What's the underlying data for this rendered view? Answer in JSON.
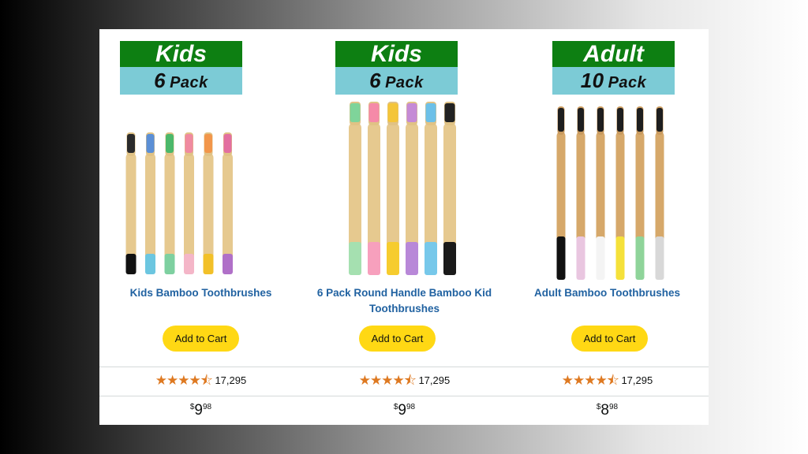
{
  "colors": {
    "badge_top": "#0d7f12",
    "badge_bottom": "#7ccbd6",
    "title_link": "#2162a1",
    "cart_button": "#ffd814",
    "stars": "#de7921"
  },
  "products": [
    {
      "badge_top": "Kids",
      "badge_count": "6",
      "badge_unit": "Pack",
      "title": "Kids Bamboo Toothbrushes",
      "cart_label": "Add to Cart",
      "rating_stars": 4.5,
      "stars_glyph": "★★★★⯪",
      "review_count": "17,295",
      "price_symbol": "$",
      "price_whole": "9",
      "price_fraction": "98",
      "bristle_colors": [
        "#2b2b2b",
        "#5b8fd6",
        "#4cb86a",
        "#f08aa0",
        "#f2964a",
        "#e36fa0"
      ],
      "tip_colors": [
        "#111111",
        "#6cc6e0",
        "#7ed0a0",
        "#f4b6c8",
        "#f2c028",
        "#b070c8"
      ]
    },
    {
      "badge_top": "Kids",
      "badge_count": "6",
      "badge_unit": "Pack",
      "title": "6 Pack Round Handle Bamboo Kid Toothbrushes",
      "cart_label": "Add to Cart",
      "rating_stars": 4.5,
      "stars_glyph": "★★★★⯪",
      "review_count": "17,295",
      "price_symbol": "$",
      "price_whole": "9",
      "price_fraction": "98",
      "bristle_colors": [
        "#7fd49a",
        "#f58aa8",
        "#f4c53a",
        "#c58ad6",
        "#6cc0e8",
        "#222222"
      ],
      "tip_colors": [
        "#a5e0b0",
        "#f7a0bd",
        "#f6cc2e",
        "#b888d8",
        "#77c8ea",
        "#1a1a1a"
      ]
    },
    {
      "badge_top": "Adult",
      "badge_count": "10",
      "badge_unit": "Pack",
      "title": "Adult Bamboo Toothbrushes",
      "cart_label": "Add to Cart",
      "rating_stars": 4.5,
      "stars_glyph": "★★★★⯪",
      "review_count": "17,295",
      "price_symbol": "$",
      "price_whole": "8",
      "price_fraction": "98",
      "bristle_colors": [
        "#1e1e1e",
        "#1e1e1e",
        "#1e1e1e",
        "#1e1e1e",
        "#1e1e1e",
        "#1e1e1e"
      ],
      "tip_colors": [
        "#111111",
        "#e9c6e0",
        "#f4f4f4",
        "#f5e13a",
        "#8fd49a",
        "#d8d8d8"
      ]
    }
  ]
}
